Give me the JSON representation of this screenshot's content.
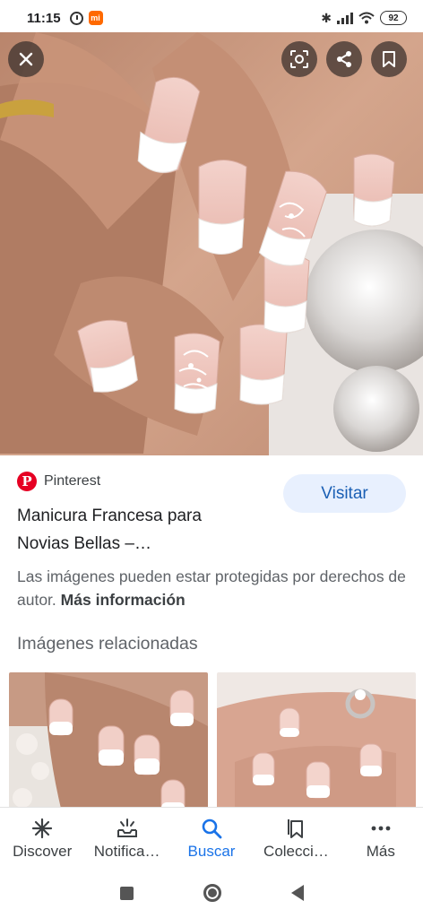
{
  "status_bar": {
    "time": "11:15",
    "battery": "92",
    "mi_badge": "mi"
  },
  "image_actions": {
    "close_icon": "close-icon",
    "lens_icon": "lens-icon",
    "share_icon": "share-icon",
    "save_icon": "bookmark-icon"
  },
  "source": {
    "site_name": "Pinterest",
    "logo_letter": "P",
    "visit_label": "Visitar"
  },
  "result": {
    "title_line1": "Manicura Francesa para",
    "title_line2": "Novias Bellas –…",
    "copyright_text": "Las imágenes pueden estar protegidas por derechos de autor.",
    "more_info": "Más información"
  },
  "related": {
    "heading": "Imágenes relacionadas"
  },
  "bottom_nav": {
    "items": [
      {
        "label": "Discover",
        "icon": "asterisk-icon"
      },
      {
        "label": "Notifica…",
        "icon": "notifications-icon"
      },
      {
        "label": "Buscar",
        "icon": "search-icon"
      },
      {
        "label": "Colecci…",
        "icon": "collections-icon"
      },
      {
        "label": "Más",
        "icon": "more-icon"
      }
    ],
    "active_index": 2
  },
  "colors": {
    "accent": "#1a73e8",
    "pinterest_red": "#e60023",
    "visit_bg": "#e8f0fe"
  }
}
